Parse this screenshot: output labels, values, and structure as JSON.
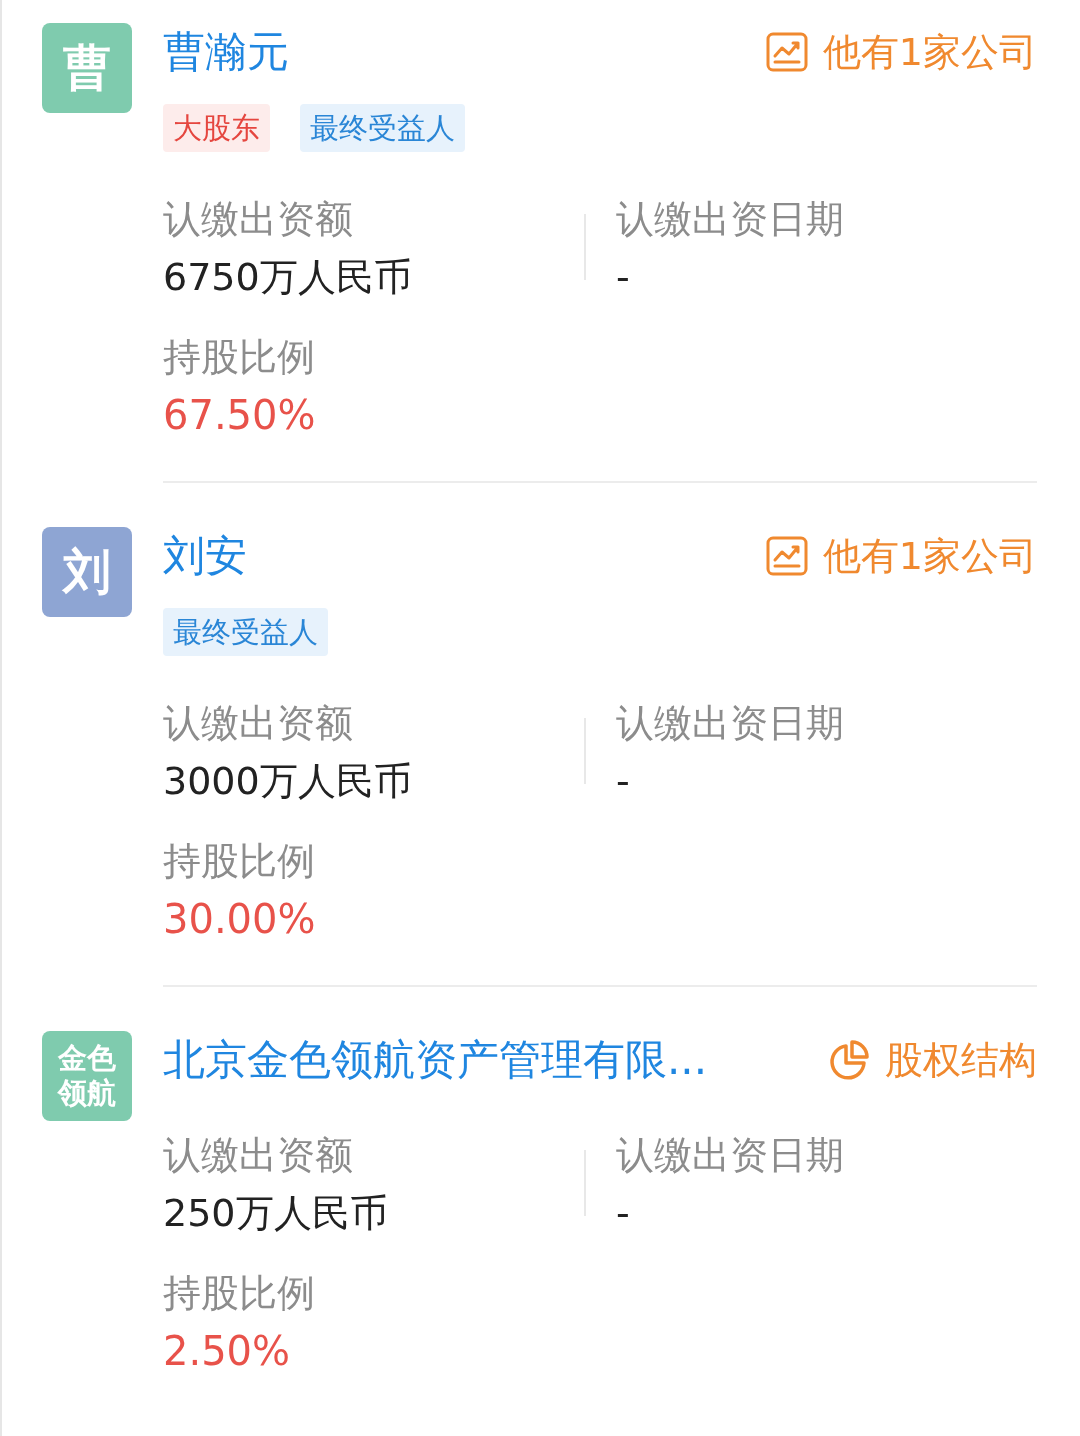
{
  "shareholders": [
    {
      "avatar": {
        "text": "曹",
        "color": "#7fcbae"
      },
      "name": "曹瀚元",
      "action": {
        "kind": "companies",
        "label": "他有1家公司"
      },
      "tags": [
        {
          "kind": "major",
          "label": "大股东"
        },
        {
          "kind": "beneficiary",
          "label": "最终受益人"
        }
      ],
      "amount_label": "认缴出资额",
      "amount": "6750万人民币",
      "date_label": "认缴出资日期",
      "date": "-",
      "ratio_label": "持股比例",
      "ratio": "67.50%"
    },
    {
      "avatar": {
        "text": "刘",
        "color": "#8ea5d3"
      },
      "name": "刘安",
      "action": {
        "kind": "companies",
        "label": "他有1家公司"
      },
      "tags": [
        {
          "kind": "beneficiary",
          "label": "最终受益人"
        }
      ],
      "amount_label": "认缴出资额",
      "amount": "3000万人民币",
      "date_label": "认缴出资日期",
      "date": "-",
      "ratio_label": "持股比例",
      "ratio": "30.00%"
    },
    {
      "avatar": {
        "text": "金色领航",
        "color": "#7fcbae"
      },
      "name": "北京金色领航资产管理有限...",
      "action": {
        "kind": "equity",
        "label": "股权结构"
      },
      "amount_label": "认缴出资额",
      "amount": "250万人民币",
      "date_label": "认缴出资日期",
      "date": "-",
      "ratio_label": "持股比例",
      "ratio": "2.50%"
    }
  ]
}
